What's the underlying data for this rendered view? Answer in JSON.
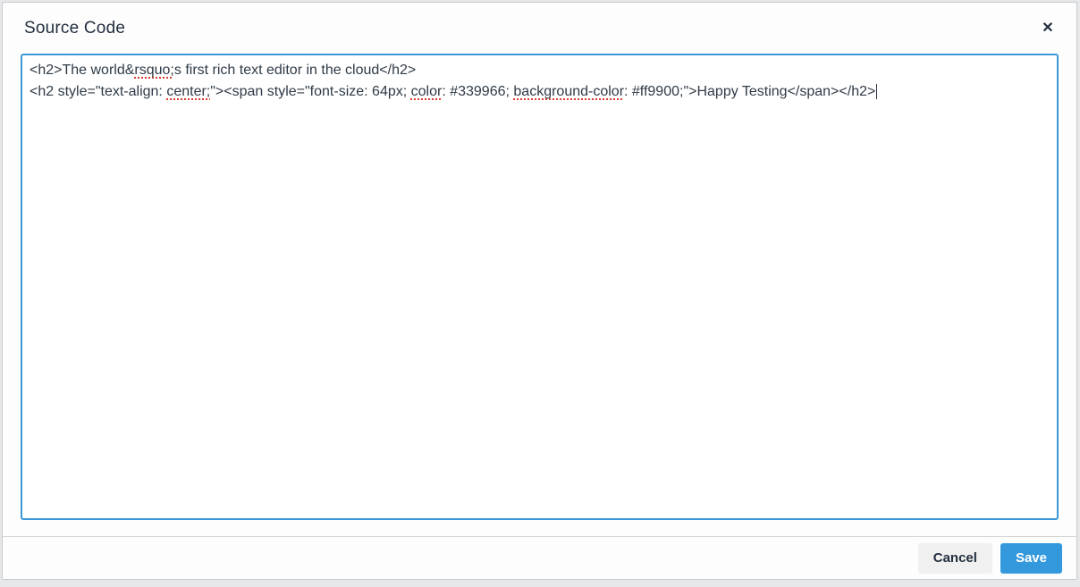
{
  "window": {
    "title": "Source Code",
    "close_icon": "✕"
  },
  "editor": {
    "lines": [
      {
        "segments": [
          {
            "text": "<h2>The world&"
          },
          {
            "text": "rsquo;",
            "misspelled": true
          },
          {
            "text": "s first rich text editor in the cloud</h2>"
          }
        ]
      },
      {
        "segments": [
          {
            "text": "<h2 style=\"text-align: "
          },
          {
            "text": "center;",
            "misspelled": true
          },
          {
            "text": "\"><span style=\"font-size: 64px; "
          },
          {
            "text": "color",
            "misspelled": true
          },
          {
            "text": ": #339966; "
          },
          {
            "text": "background-color",
            "misspelled": true
          },
          {
            "text": ": #ff9900;\">Happy Testing</span></h2>"
          }
        ],
        "caret": true
      }
    ]
  },
  "footer": {
    "cancel_label": "Cancel",
    "save_label": "Save"
  },
  "colors": {
    "accent": "#3399dc",
    "focus_border": "#3e97d6",
    "title_text": "#222f3e",
    "misspell_red": "#dd3b2f"
  }
}
